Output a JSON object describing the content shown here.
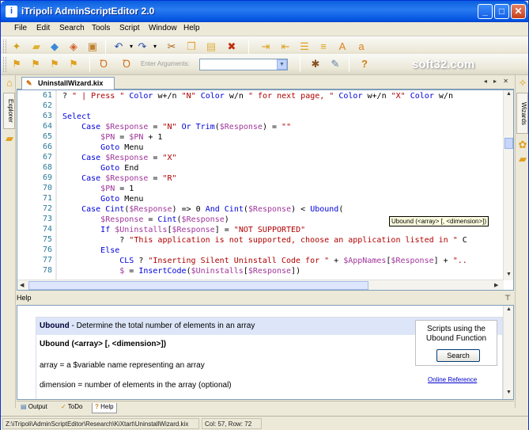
{
  "window": {
    "title": "iTripoli AdminScriptEditor 2.0",
    "minimize": "_",
    "maximize": "□",
    "close": "✕"
  },
  "menu": [
    "File",
    "Edit",
    "Search",
    "Tools",
    "Script",
    "Window",
    "Help"
  ],
  "toolbar": {
    "args_label": "Enter Arguments:",
    "args_value": "",
    "brand": "soft32.com"
  },
  "side_tabs": {
    "left": "Explorer",
    "right": "Wizards"
  },
  "doc_tab": {
    "name": "UninstallWizard.kix",
    "nav": "◂ ▸ ✕"
  },
  "editor": {
    "lines": [
      {
        "num": "61",
        "text": "? \" | Press \" Color w+/n \"N\" Color w/n \" for next page, \" Color w+/n \"X\" Color w/n"
      },
      {
        "num": "62",
        "text": ""
      },
      {
        "num": "63",
        "text": "Select"
      },
      {
        "num": "64",
        "text": "    Case $Response = \"N\" Or Trim($Response) = \"\""
      },
      {
        "num": "65",
        "text": "        $PN = $PN + 1"
      },
      {
        "num": "66",
        "text": "        Goto Menu"
      },
      {
        "num": "67",
        "text": "    Case $Response = \"X\""
      },
      {
        "num": "68",
        "text": "        Goto End"
      },
      {
        "num": "69",
        "text": "    Case $Response = \"R\""
      },
      {
        "num": "70",
        "text": "        $PN = 1"
      },
      {
        "num": "71",
        "text": "        Goto Menu"
      },
      {
        "num": "72",
        "text": "    Case Cint($Response) => 0 And Cint($Response) < Ubound("
      },
      {
        "num": "73",
        "text": "        $Response = Cint($Response)"
      },
      {
        "num": "74",
        "text": "        If $Uninstalls[$Response] = \"NOT SUPPORTED\""
      },
      {
        "num": "75",
        "text": "            ? \"This application is not supported, choose an application listed in \" C"
      },
      {
        "num": "76",
        "text": "        Else"
      },
      {
        "num": "77",
        "text": "            CLS ? \"Inserting Silent Uninstall Code for \" + $AppNames[$Response] + \".."
      },
      {
        "num": "78",
        "text": "            $ = InsertCode($Uninstalls[$Response])"
      }
    ],
    "hint": "Ubound (<array> [, <dimension>])"
  },
  "help": {
    "header": "Help",
    "title_name": "Ubound",
    "title_desc": " - Determine the total number of elements in an array",
    "syntax": "Ubound (<array> [, <dimension>])",
    "param1": "array = a $variable name representing an array",
    "param2": "dimension = number of elements in the array (optional)",
    "scripts_box_text": "Scripts using the Ubound Function",
    "search_button": "Search",
    "online_ref": "Online Reference"
  },
  "bottom_tabs": [
    "Output",
    "ToDo",
    "Help"
  ],
  "status": {
    "path": "Z:\\iTripoli\\AdminScriptEditor\\Research\\KiXtart\\UninstallWizard.kix",
    "pos": "Col: 57, Row: 72"
  },
  "colors": {
    "title_bar": "#0a5fde",
    "keyword": "#0000dd",
    "string": "#b00000",
    "variable": "#a0369a",
    "line_number": "#2a7a9a"
  }
}
